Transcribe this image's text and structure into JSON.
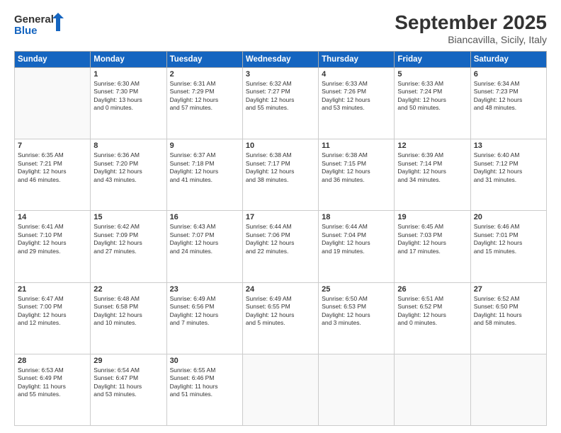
{
  "header": {
    "logo_line1": "General",
    "logo_line2": "Blue",
    "title": "September 2025",
    "subtitle": "Biancavilla, Sicily, Italy"
  },
  "calendar": {
    "days_of_week": [
      "Sunday",
      "Monday",
      "Tuesday",
      "Wednesday",
      "Thursday",
      "Friday",
      "Saturday"
    ],
    "weeks": [
      [
        {
          "num": "",
          "info": ""
        },
        {
          "num": "1",
          "info": "Sunrise: 6:30 AM\nSunset: 7:30 PM\nDaylight: 13 hours\nand 0 minutes."
        },
        {
          "num": "2",
          "info": "Sunrise: 6:31 AM\nSunset: 7:29 PM\nDaylight: 12 hours\nand 57 minutes."
        },
        {
          "num": "3",
          "info": "Sunrise: 6:32 AM\nSunset: 7:27 PM\nDaylight: 12 hours\nand 55 minutes."
        },
        {
          "num": "4",
          "info": "Sunrise: 6:33 AM\nSunset: 7:26 PM\nDaylight: 12 hours\nand 53 minutes."
        },
        {
          "num": "5",
          "info": "Sunrise: 6:33 AM\nSunset: 7:24 PM\nDaylight: 12 hours\nand 50 minutes."
        },
        {
          "num": "6",
          "info": "Sunrise: 6:34 AM\nSunset: 7:23 PM\nDaylight: 12 hours\nand 48 minutes."
        }
      ],
      [
        {
          "num": "7",
          "info": "Sunrise: 6:35 AM\nSunset: 7:21 PM\nDaylight: 12 hours\nand 46 minutes."
        },
        {
          "num": "8",
          "info": "Sunrise: 6:36 AM\nSunset: 7:20 PM\nDaylight: 12 hours\nand 43 minutes."
        },
        {
          "num": "9",
          "info": "Sunrise: 6:37 AM\nSunset: 7:18 PM\nDaylight: 12 hours\nand 41 minutes."
        },
        {
          "num": "10",
          "info": "Sunrise: 6:38 AM\nSunset: 7:17 PM\nDaylight: 12 hours\nand 38 minutes."
        },
        {
          "num": "11",
          "info": "Sunrise: 6:38 AM\nSunset: 7:15 PM\nDaylight: 12 hours\nand 36 minutes."
        },
        {
          "num": "12",
          "info": "Sunrise: 6:39 AM\nSunset: 7:14 PM\nDaylight: 12 hours\nand 34 minutes."
        },
        {
          "num": "13",
          "info": "Sunrise: 6:40 AM\nSunset: 7:12 PM\nDaylight: 12 hours\nand 31 minutes."
        }
      ],
      [
        {
          "num": "14",
          "info": "Sunrise: 6:41 AM\nSunset: 7:10 PM\nDaylight: 12 hours\nand 29 minutes."
        },
        {
          "num": "15",
          "info": "Sunrise: 6:42 AM\nSunset: 7:09 PM\nDaylight: 12 hours\nand 27 minutes."
        },
        {
          "num": "16",
          "info": "Sunrise: 6:43 AM\nSunset: 7:07 PM\nDaylight: 12 hours\nand 24 minutes."
        },
        {
          "num": "17",
          "info": "Sunrise: 6:44 AM\nSunset: 7:06 PM\nDaylight: 12 hours\nand 22 minutes."
        },
        {
          "num": "18",
          "info": "Sunrise: 6:44 AM\nSunset: 7:04 PM\nDaylight: 12 hours\nand 19 minutes."
        },
        {
          "num": "19",
          "info": "Sunrise: 6:45 AM\nSunset: 7:03 PM\nDaylight: 12 hours\nand 17 minutes."
        },
        {
          "num": "20",
          "info": "Sunrise: 6:46 AM\nSunset: 7:01 PM\nDaylight: 12 hours\nand 15 minutes."
        }
      ],
      [
        {
          "num": "21",
          "info": "Sunrise: 6:47 AM\nSunset: 7:00 PM\nDaylight: 12 hours\nand 12 minutes."
        },
        {
          "num": "22",
          "info": "Sunrise: 6:48 AM\nSunset: 6:58 PM\nDaylight: 12 hours\nand 10 minutes."
        },
        {
          "num": "23",
          "info": "Sunrise: 6:49 AM\nSunset: 6:56 PM\nDaylight: 12 hours\nand 7 minutes."
        },
        {
          "num": "24",
          "info": "Sunrise: 6:49 AM\nSunset: 6:55 PM\nDaylight: 12 hours\nand 5 minutes."
        },
        {
          "num": "25",
          "info": "Sunrise: 6:50 AM\nSunset: 6:53 PM\nDaylight: 12 hours\nand 3 minutes."
        },
        {
          "num": "26",
          "info": "Sunrise: 6:51 AM\nSunset: 6:52 PM\nDaylight: 12 hours\nand 0 minutes."
        },
        {
          "num": "27",
          "info": "Sunrise: 6:52 AM\nSunset: 6:50 PM\nDaylight: 11 hours\nand 58 minutes."
        }
      ],
      [
        {
          "num": "28",
          "info": "Sunrise: 6:53 AM\nSunset: 6:49 PM\nDaylight: 11 hours\nand 55 minutes."
        },
        {
          "num": "29",
          "info": "Sunrise: 6:54 AM\nSunset: 6:47 PM\nDaylight: 11 hours\nand 53 minutes."
        },
        {
          "num": "30",
          "info": "Sunrise: 6:55 AM\nSunset: 6:46 PM\nDaylight: 11 hours\nand 51 minutes."
        },
        {
          "num": "",
          "info": ""
        },
        {
          "num": "",
          "info": ""
        },
        {
          "num": "",
          "info": ""
        },
        {
          "num": "",
          "info": ""
        }
      ]
    ]
  }
}
